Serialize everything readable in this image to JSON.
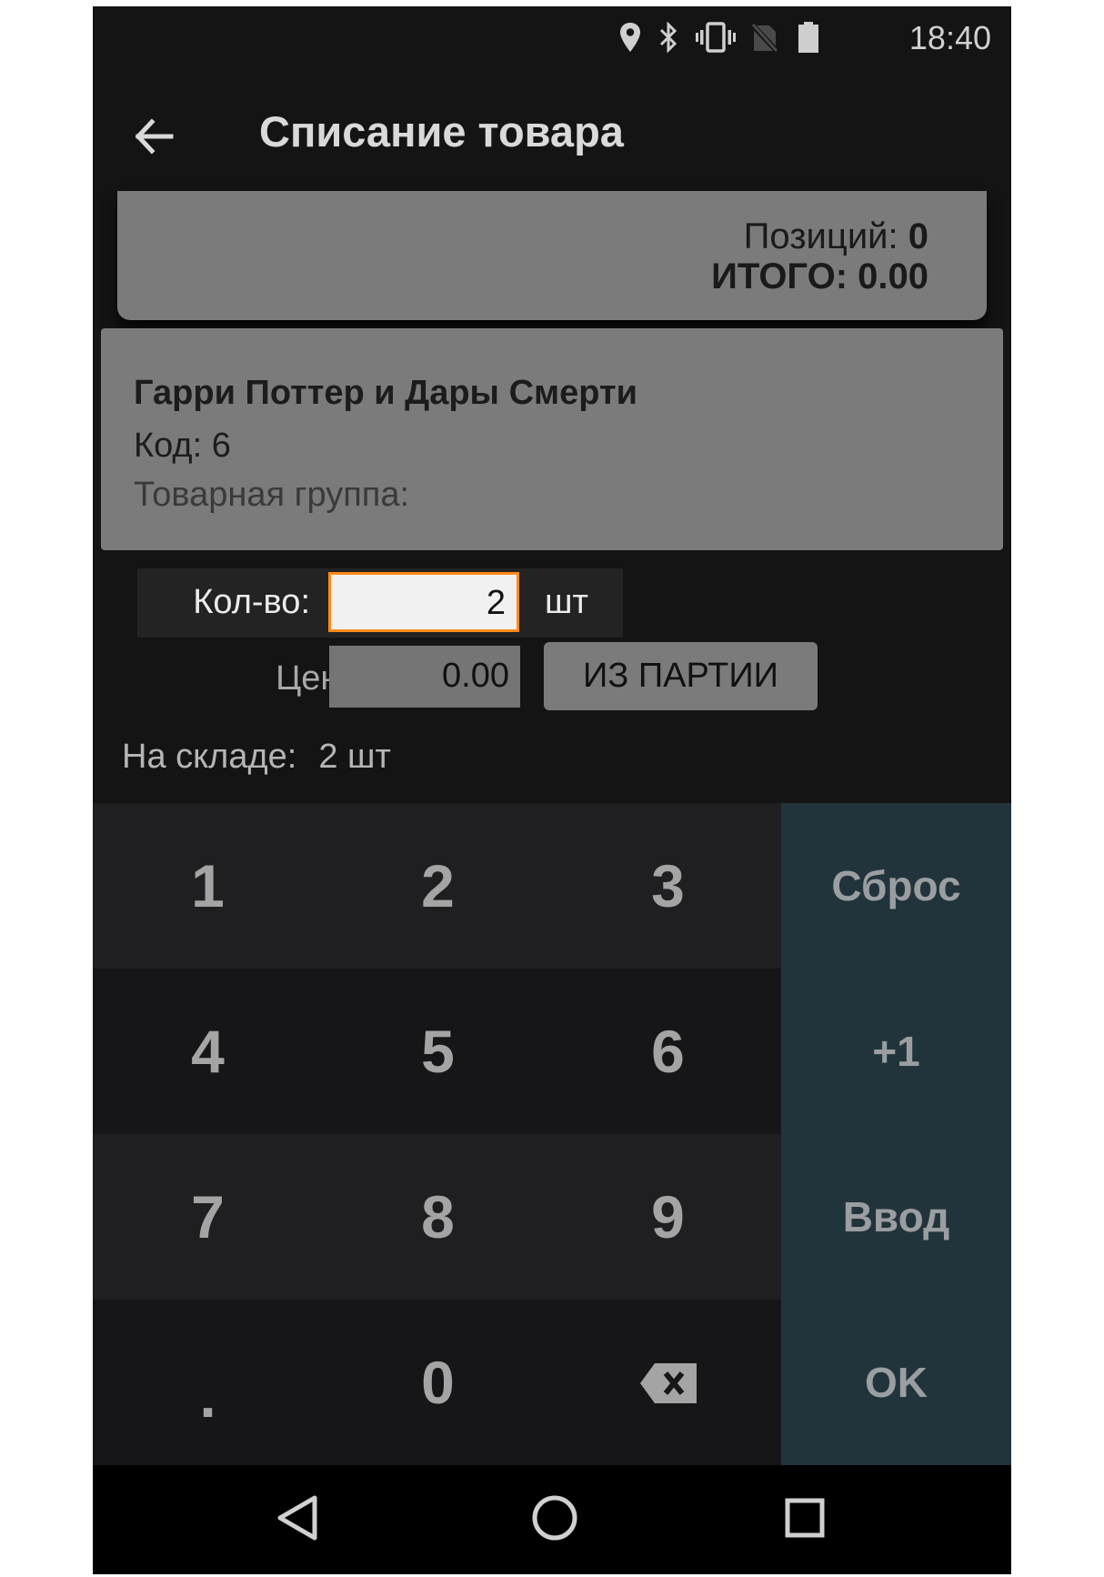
{
  "status_bar": {
    "time": "18:40",
    "icons": [
      "location-icon",
      "bluetooth-icon",
      "vibrate-icon",
      "no-sim-icon",
      "battery-icon"
    ]
  },
  "app_bar": {
    "title": "Списание товара",
    "back_icon": "arrow-left-icon"
  },
  "totals": {
    "positions_label": "Позиций:",
    "positions_value": "0",
    "total_label": "ИТОГО:",
    "total_value": "0.00"
  },
  "product": {
    "name": "Гарри Поттер и Дары Смерти",
    "code": "Код: 6",
    "group": "Товарная группа:"
  },
  "quantity": {
    "label": "Кол-во:",
    "value": "2",
    "unit": "шт"
  },
  "price": {
    "label": "Цена:",
    "value": "0.00",
    "batch_button": "ИЗ ПАРТИИ"
  },
  "stock": {
    "label": "На складе:",
    "value": "2 шт"
  },
  "keypad": {
    "keys": [
      "1",
      "2",
      "3",
      "Сброс",
      "4",
      "5",
      "6",
      "+1",
      "7",
      "8",
      "9",
      "Ввод",
      ".",
      "0",
      "backspace",
      "OK"
    ]
  },
  "nav_bar": {
    "icons": [
      "back-triangle-icon",
      "home-circle-icon",
      "recents-square-icon"
    ]
  },
  "colors": {
    "accent": "#ff8a1a",
    "background": "#141414",
    "card": "#7b7b7b",
    "function_key": "#22343b"
  }
}
